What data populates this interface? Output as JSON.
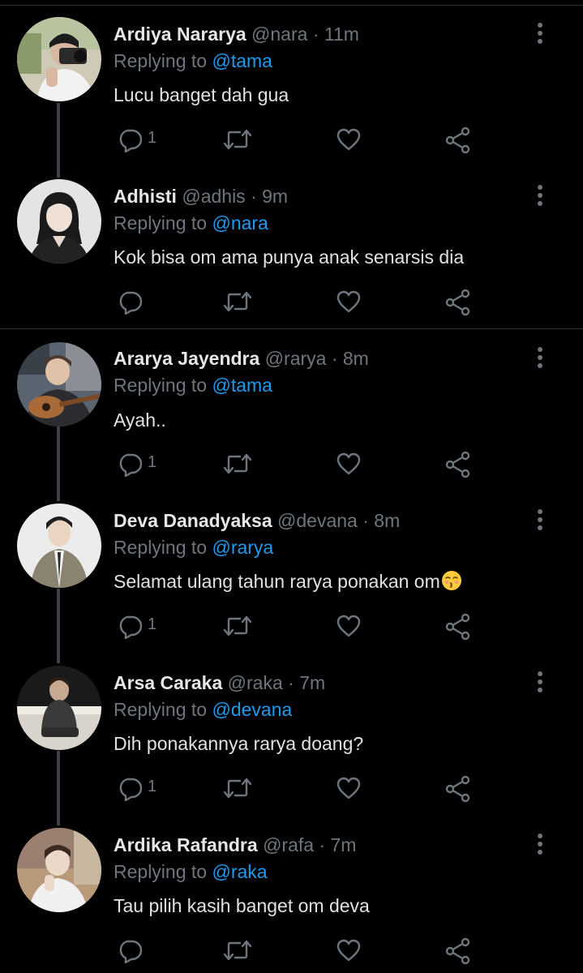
{
  "colors": {
    "background": "#000000",
    "name": "#e6e6e6",
    "muted": "#6e767d",
    "mention": "#1d9bf0",
    "text": "#e1e1e1",
    "divider": "#2f3336",
    "thread_line": "#3d4145"
  },
  "tweets": [
    {
      "name": "Ardiya Nararya",
      "handle": "@nara",
      "dot": "·",
      "time": "11m",
      "replying_label": "Replying to",
      "replying_to": "@tama",
      "text": "Lucu banget dah gua",
      "reply_count": "1",
      "avatar_icon": "avatar-photo-camera"
    },
    {
      "name": "Adhisti",
      "handle": "@adhis",
      "dot": "·",
      "time": "9m",
      "replying_label": "Replying to",
      "replying_to": "@nara",
      "text": "Kok bisa om ama punya anak senarsis dia",
      "reply_count": "",
      "avatar_icon": "avatar-photo-woman"
    },
    {
      "name": "Ararya Jayendra",
      "handle": "@rarya",
      "dot": "·",
      "time": "8m",
      "replying_label": "Replying to",
      "replying_to": "@tama",
      "text": "Ayah..",
      "reply_count": "1",
      "avatar_icon": "avatar-photo-guitar"
    },
    {
      "name": "Deva Danadyaksa",
      "handle": "@devana",
      "dot": "·",
      "time": "8m",
      "replying_label": "Replying to",
      "replying_to": "@rarya",
      "text": "Selamat ulang tahun rarya ponakan om",
      "text_emoji": "kissing-face-emoji",
      "reply_count": "1",
      "avatar_icon": "avatar-photo-suit"
    },
    {
      "name": "Arsa Caraka",
      "handle": "@raka",
      "dot": "·",
      "time": "7m",
      "replying_label": "Replying to",
      "replying_to": "@devana",
      "text": "Dih ponakannya rarya doang?",
      "reply_count": "1",
      "avatar_icon": "avatar-photo-sitting"
    },
    {
      "name": "Ardika Rafandra",
      "handle": "@rafa",
      "dot": "·",
      "time": "7m",
      "replying_label": "Replying to",
      "replying_to": "@raka",
      "text": "Tau pilih kasih banget om deva",
      "reply_count": "",
      "avatar_icon": "avatar-photo-outdoor"
    }
  ]
}
